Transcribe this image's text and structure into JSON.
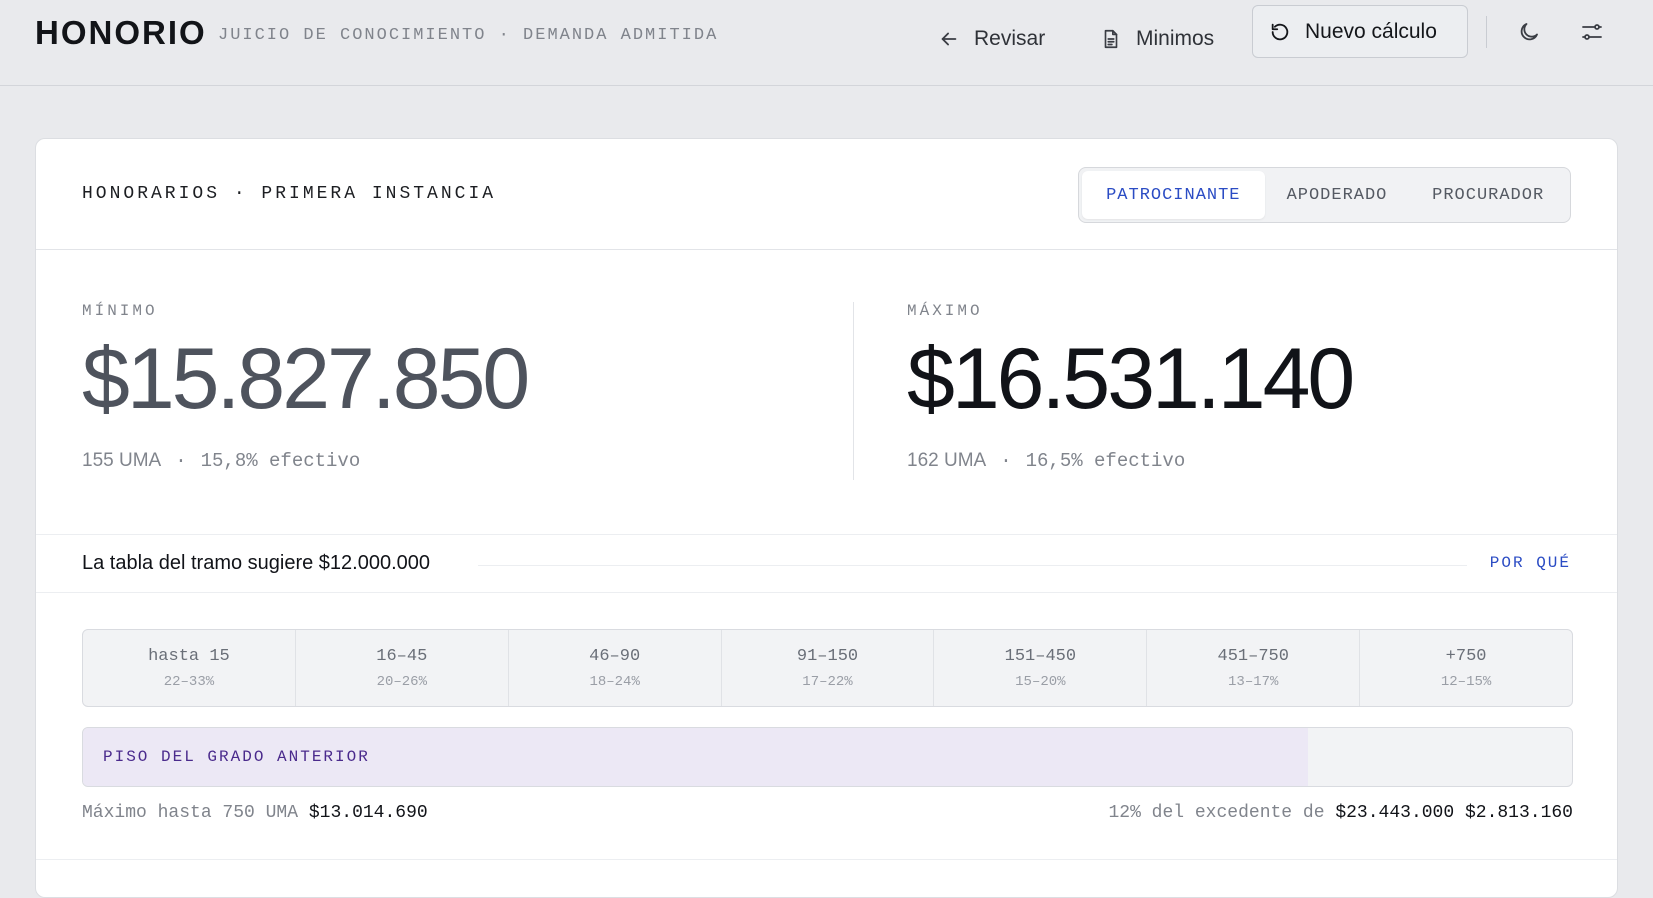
{
  "header": {
    "brand": "HONORIO",
    "breadcrumb": "JUICIO DE CONOCIMIENTO · DEMANDA ADMITIDA",
    "nav": {
      "revisar": "Revisar",
      "minimos": "Minimos",
      "nuevo": "Nuevo cálculo"
    }
  },
  "card": {
    "title": "HONORARIOS · PRIMERA INSTANCIA",
    "roles": [
      "PATROCINANTE",
      "APODERADO",
      "PROCURADOR"
    ],
    "active_role": "PATROCINANTE"
  },
  "figures": {
    "min": {
      "label": "MÍNIMO",
      "amount": "$15.827.850",
      "uma": "155 UMA",
      "sep": "·",
      "effective": "15,8% efectivo"
    },
    "max": {
      "label": "MÁXIMO",
      "amount": "$16.531.140",
      "uma": "162 UMA",
      "sep": "·",
      "effective": "16,5% efectivo"
    }
  },
  "suggest": {
    "text": "La tabla del tramo sugiere $12.000.000",
    "link": "POR QUÉ"
  },
  "tramos": [
    {
      "range": "hasta 15",
      "pct": "22–33%"
    },
    {
      "range": "16–45",
      "pct": "20–26%"
    },
    {
      "range": "46–90",
      "pct": "18–24%"
    },
    {
      "range": "91–150",
      "pct": "17–22%"
    },
    {
      "range": "151–450",
      "pct": "15–20%"
    },
    {
      "range": "451–750",
      "pct": "13–17%"
    },
    {
      "range": "+750",
      "pct": "12–15%"
    }
  ],
  "active_tramo": 6,
  "floor": {
    "label": "PISO DEL GRADO ANTERIOR",
    "fill_fraction": 0.823
  },
  "footer": {
    "left_label": "Máximo hasta 750 UMA",
    "left_value": "$13.014.690",
    "right_label": "12% del excedente de",
    "right_base": "$23.443.000",
    "right_value": "$2.813.160"
  },
  "colors": {
    "accent": "#2b4cc4",
    "tramo_active": "#6a3cb8",
    "background": "#e9eaed"
  }
}
